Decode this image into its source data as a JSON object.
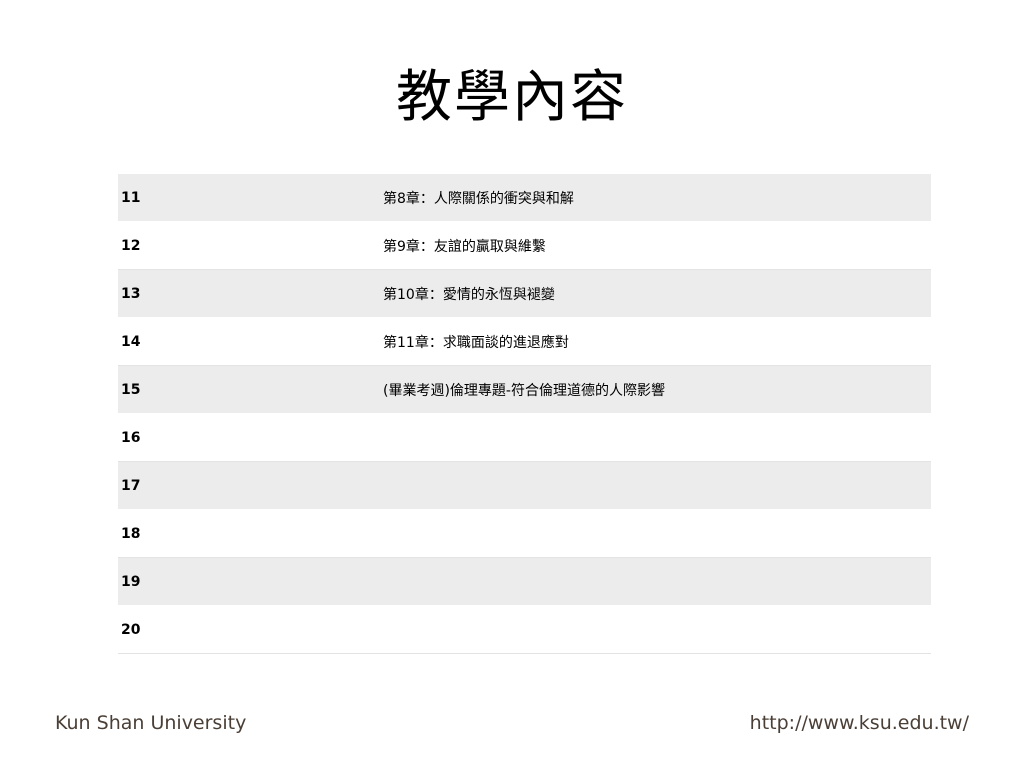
{
  "title": "教學內容",
  "rows": [
    {
      "week": "11",
      "content": "第8章：人際關係的衝突與和解"
    },
    {
      "week": "12",
      "content": "第9章：友誼的贏取與維繫"
    },
    {
      "week": "13",
      "content": "第10章：愛情的永恆與褪變"
    },
    {
      "week": "14",
      "content": "第11章：求職面談的進退應對"
    },
    {
      "week": "15",
      "content": "(畢業考週)倫理專題-符合倫理道德的人際影響"
    },
    {
      "week": "16",
      "content": ""
    },
    {
      "week": "17",
      "content": ""
    },
    {
      "week": "18",
      "content": ""
    },
    {
      "week": "19",
      "content": ""
    },
    {
      "week": "20",
      "content": ""
    }
  ],
  "footer": {
    "left": "Kun Shan University",
    "right": "http://www.ksu.edu.tw/"
  },
  "colors": {
    "band_row": "#ececec",
    "plain_row": "#ffffff",
    "footer_text": "#4a3f36"
  }
}
